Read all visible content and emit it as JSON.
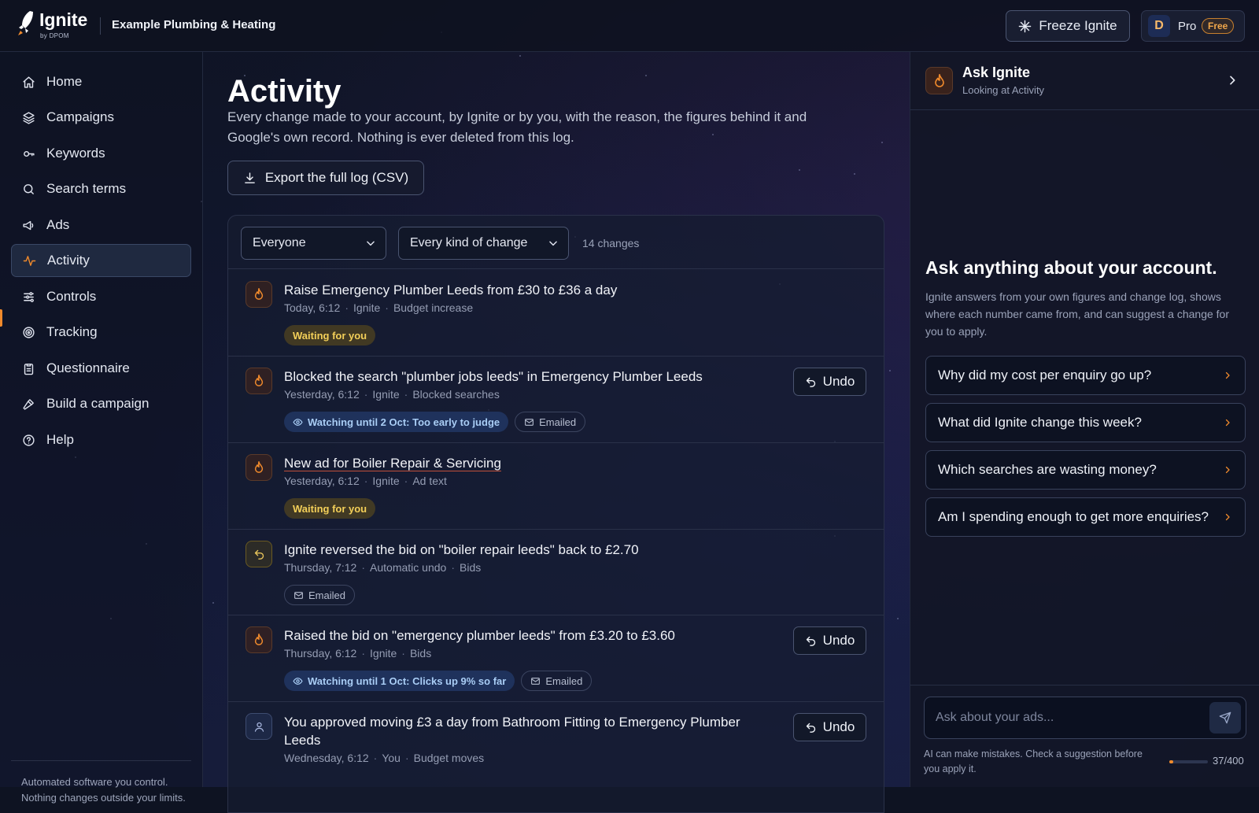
{
  "brand": {
    "name": "Ignite",
    "sub": "by DPOM",
    "org": "Example Plumbing & Heating"
  },
  "header": {
    "freeze_label": "Freeze Ignite",
    "avatar_initial": "D",
    "plan": "Pro",
    "plan_badge": "Free"
  },
  "sidebar": {
    "items": [
      {
        "label": "Home",
        "icon": "home-icon"
      },
      {
        "label": "Campaigns",
        "icon": "layers-icon"
      },
      {
        "label": "Keywords",
        "icon": "key-icon"
      },
      {
        "label": "Search terms",
        "icon": "search-icon"
      },
      {
        "label": "Ads",
        "icon": "megaphone-icon"
      },
      {
        "label": "Activity",
        "icon": "activity-icon",
        "active": true
      },
      {
        "label": "Controls",
        "icon": "sliders-icon"
      },
      {
        "label": "Tracking",
        "icon": "target-icon"
      },
      {
        "label": "Questionnaire",
        "icon": "clipboard-icon"
      },
      {
        "label": "Build a campaign",
        "icon": "hammer-icon"
      },
      {
        "label": "Help",
        "icon": "help-icon"
      }
    ],
    "footer": "Automated software you control. Nothing changes outside your limits."
  },
  "main": {
    "title": "Activity",
    "description": "Every change made to your account, by Ignite or by you, with the reason, the figures behind it and Google's own record. Nothing is ever deleted from this log.",
    "export_label": "Export the full log (CSV)",
    "filters": {
      "who": "Everyone",
      "kind": "Every kind of change",
      "count": "14 changes"
    },
    "undo_label": "Undo",
    "entries": [
      {
        "title": "Raise Emergency Plumber Leeds from £30 to £36 a day",
        "time": "Today, 6:12",
        "actor": "Ignite",
        "category": "Budget increase",
        "tags": [
          {
            "type": "waiting",
            "text": "Waiting for you"
          }
        ]
      },
      {
        "title": "Blocked the search \"plumber jobs leeds\" in Emergency Plumber Leeds",
        "time": "Yesterday, 6:12",
        "actor": "Ignite",
        "category": "Blocked searches",
        "tags": [
          {
            "type": "watching",
            "text": "Watching until 2 Oct: Too early to judge"
          },
          {
            "type": "emailed",
            "text": "Emailed"
          }
        ]
      },
      {
        "title": "New ad for Boiler Repair & Servicing",
        "time": "Yesterday, 6:12",
        "actor": "Ignite",
        "category": "Ad text",
        "tags": [
          {
            "type": "waiting",
            "text": "Waiting for you"
          }
        ]
      },
      {
        "title": "Ignite reversed the bid on \"boiler repair leeds\" back to £2.70",
        "time": "Thursday, 7:12",
        "actor": "Automatic undo",
        "category": "Bids",
        "tags": [
          {
            "type": "emailed",
            "text": "Emailed"
          }
        ]
      },
      {
        "title": "Raised the bid on \"emergency plumber leeds\" from £3.20 to £3.60",
        "time": "Thursday, 6:12",
        "actor": "Ignite",
        "category": "Bids",
        "tags": [
          {
            "type": "watching",
            "text": "Watching until 1 Oct: Clicks up 9% so far"
          },
          {
            "type": "emailed",
            "text": "Emailed"
          }
        ]
      },
      {
        "title": "You approved moving £3 a day from Bathroom Fitting to Emergency Plumber Leeds",
        "time": "Wednesday, 6:12",
        "actor": "You",
        "category": "Budget moves",
        "tags": []
      }
    ]
  },
  "assistant": {
    "title": "Ask Ignite",
    "subtitle": "Looking at Activity",
    "heading": "Ask anything about your account.",
    "intro": "Ignite answers from your own figures and change log, shows where each number came from, and can suggest a change for you to apply.",
    "suggestions": [
      "Why did my cost per enquiry go up?",
      "What did Ignite change this week?",
      "Which searches are wasting money?",
      "Am I spending enough to get more enquiries?"
    ],
    "input_placeholder": "Ask about your ads...",
    "disclaimer": "AI can make mistakes. Check a suggestion before you apply it.",
    "char_count": "37/400",
    "char_fraction": 0.0925
  },
  "colors": {
    "accent": "#f08a2c",
    "waiting": "#f3cf59",
    "watching": "#a9cdf5"
  }
}
